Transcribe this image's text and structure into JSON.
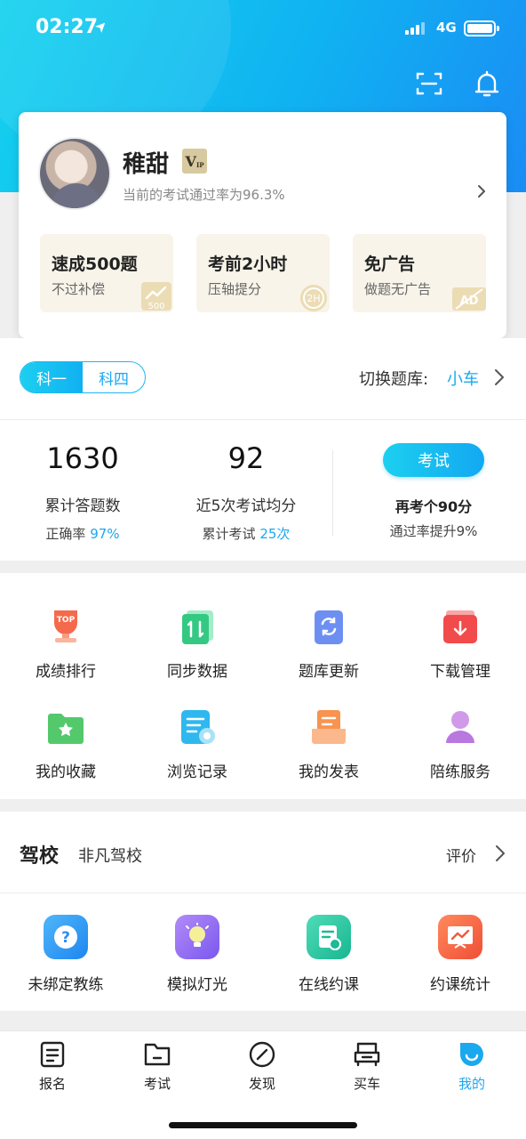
{
  "status_bar": {
    "time": "02:27",
    "location_arrow": "➤",
    "network": "4G"
  },
  "header": {
    "scan_icon": "scan-icon",
    "bell_icon": "bell-icon"
  },
  "profile": {
    "name": "稚甜",
    "vip_badge": "V",
    "vip_badge_sub": "IP",
    "pass_rate_text": "当前的考试通过率为96.3%"
  },
  "promos": [
    {
      "title": "速成500题",
      "subtitle": "不过补偿",
      "badge": "500"
    },
    {
      "title": "考前2小时",
      "subtitle": "压轴提分",
      "badge": "2H"
    },
    {
      "title": "免广告",
      "subtitle": "做题无广告",
      "badge": "AD"
    }
  ],
  "subjects": {
    "tabs": [
      "科一",
      "科四"
    ],
    "active": "科一",
    "switch_label": "切换题库:",
    "switch_value": "小车"
  },
  "stats": {
    "total_answered": "1630",
    "total_answered_label": "累计答题数",
    "accuracy_label": "正确率",
    "accuracy_value": "97%",
    "avg_score": "92",
    "avg_score_label": "近5次考试均分",
    "exam_count_label": "累计考试",
    "exam_count_value": "25次",
    "exam_button": "考试",
    "retake_text": "再考个90分",
    "boost_text": "通过率提升9%"
  },
  "features": [
    {
      "label": "成绩排行",
      "icon": "trophy-icon"
    },
    {
      "label": "同步数据",
      "icon": "sync-icon"
    },
    {
      "label": "题库更新",
      "icon": "refresh-icon"
    },
    {
      "label": "下载管理",
      "icon": "download-icon"
    },
    {
      "label": "我的收藏",
      "icon": "star-folder-icon"
    },
    {
      "label": "浏览记录",
      "icon": "history-icon"
    },
    {
      "label": "我的发表",
      "icon": "posts-icon"
    },
    {
      "label": "陪练服务",
      "icon": "coach-icon"
    }
  ],
  "school": {
    "title": "驾校",
    "name": "非凡驾校",
    "rate_label": "评价",
    "items": [
      {
        "label": "未绑定教练",
        "icon": "question-icon",
        "color": "#2d9cf4"
      },
      {
        "label": "模拟灯光",
        "icon": "lightbulb-icon",
        "color": "#8c6cf2"
      },
      {
        "label": "在线约课",
        "icon": "schedule-icon",
        "color": "#23c2a3"
      },
      {
        "label": "约课统计",
        "icon": "chart-icon",
        "color": "#f5603f"
      }
    ]
  },
  "tabbar": [
    {
      "label": "报名",
      "icon": "signup-icon"
    },
    {
      "label": "考试",
      "icon": "exam-folder-icon"
    },
    {
      "label": "发现",
      "icon": "compass-icon"
    },
    {
      "label": "买车",
      "icon": "car-icon"
    },
    {
      "label": "我的",
      "icon": "profile-icon",
      "active": true
    }
  ],
  "colors": {
    "accent": "#1aa8ef",
    "hero_start": "#14d2ee",
    "hero_end": "#1a8cf5"
  }
}
